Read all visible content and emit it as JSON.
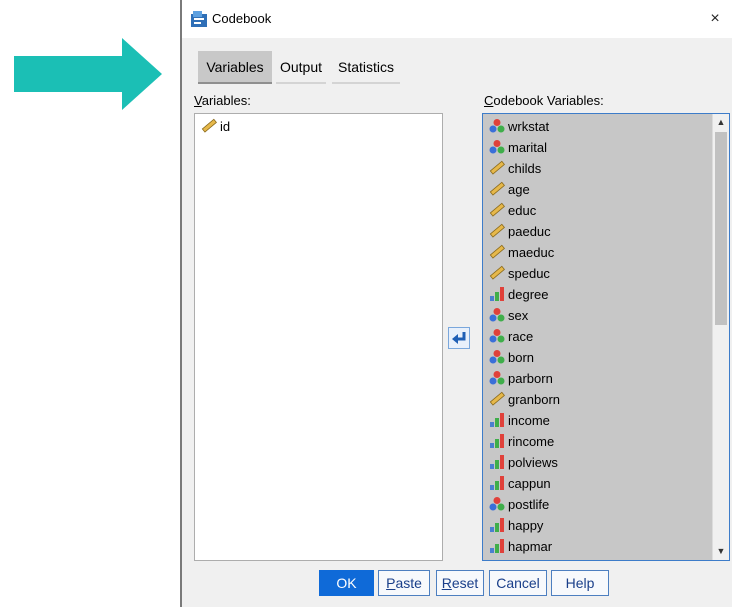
{
  "dialog": {
    "title": "Codebook",
    "close_symbol": "×"
  },
  "tabs": [
    {
      "label": "Variables"
    },
    {
      "label": "Output"
    },
    {
      "label": "Statistics"
    }
  ],
  "variables_label_accel": "V",
  "variables_label_rest": "ariables:",
  "codebook_label_accel": "C",
  "codebook_label_rest": "odebook Variables:",
  "variables_list": [
    {
      "name": "id",
      "icon": "scale-icon"
    }
  ],
  "codebook_list": [
    {
      "name": "wrkstat",
      "icon": "nominal-icon"
    },
    {
      "name": "marital",
      "icon": "nominal-icon"
    },
    {
      "name": "childs",
      "icon": "scale-icon"
    },
    {
      "name": "age",
      "icon": "scale-icon"
    },
    {
      "name": "educ",
      "icon": "scale-icon"
    },
    {
      "name": "paeduc",
      "icon": "scale-icon"
    },
    {
      "name": "maeduc",
      "icon": "scale-icon"
    },
    {
      "name": "speduc",
      "icon": "scale-icon"
    },
    {
      "name": "degree",
      "icon": "ordinal-icon"
    },
    {
      "name": "sex",
      "icon": "nominal-icon"
    },
    {
      "name": "race",
      "icon": "nominal-icon"
    },
    {
      "name": "born",
      "icon": "nominal-icon"
    },
    {
      "name": "parborn",
      "icon": "nominal-icon"
    },
    {
      "name": "granborn",
      "icon": "scale-icon"
    },
    {
      "name": "income",
      "icon": "ordinal-icon"
    },
    {
      "name": "rincome",
      "icon": "ordinal-icon"
    },
    {
      "name": "polviews",
      "icon": "ordinal-icon"
    },
    {
      "name": "cappun",
      "icon": "ordinal-icon"
    },
    {
      "name": "postlife",
      "icon": "nominal-icon"
    },
    {
      "name": "happy",
      "icon": "ordinal-icon"
    },
    {
      "name": "hapmar",
      "icon": "ordinal-icon"
    }
  ],
  "buttons": {
    "ok": "OK",
    "paste_accel": "P",
    "paste_rest": "aste",
    "reset_accel": "R",
    "reset_rest": "eset",
    "cancel": "Cancel",
    "help": "Help"
  },
  "colors": {
    "arrow": "#1bbfb5",
    "accent": "#0f6ad8",
    "list_selection": "#c7c7c7"
  }
}
